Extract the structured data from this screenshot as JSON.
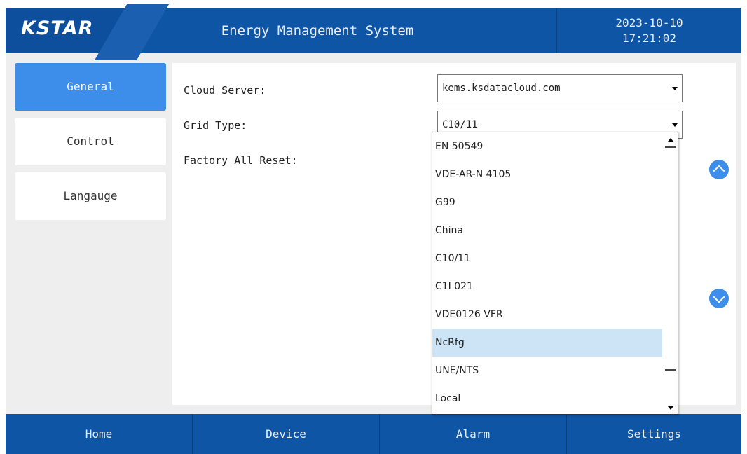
{
  "header": {
    "logo": "KSTAR",
    "title": "Energy Management System",
    "date": "2023-10-10",
    "time": "17:21:02"
  },
  "menu": {
    "items": [
      {
        "label": "General",
        "active": true
      },
      {
        "label": "Control",
        "active": false
      },
      {
        "label": "Langauge",
        "active": false
      }
    ]
  },
  "settings": {
    "cloud_server_label": "Cloud Server:",
    "cloud_server_value": "kems.ksdatacloud.com",
    "grid_type_label": "Grid Type:",
    "grid_type_value": "C10/11",
    "factory_reset_label": "Factory All Reset:"
  },
  "dropdown": {
    "options": [
      "EN 50549",
      "VDE-AR-N 4105",
      "G99",
      "China",
      "C10/11",
      "C1I 021",
      "VDE0126 VFR",
      "NcRfg",
      "UNE/NTS",
      "Local"
    ],
    "highlighted": "NcRfg"
  },
  "nav": {
    "home": "Home",
    "device": "Device",
    "alarm": "Alarm",
    "settings": "Settings"
  },
  "colors": {
    "header_bg": "#0f55a6",
    "accent": "#3d8eea",
    "highlight": "#cde4f7"
  }
}
